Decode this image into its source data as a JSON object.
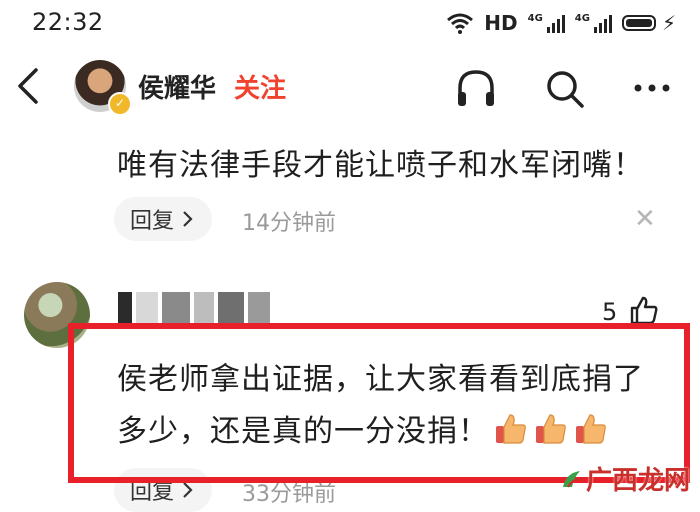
{
  "status_bar": {
    "time": "22:32",
    "hd": "HD",
    "net1": "4G",
    "net2": "4G"
  },
  "header": {
    "username": "侯耀华",
    "follow_label": "关注",
    "icons": [
      "back-icon",
      "headphones-icon",
      "search-icon",
      "more-icon"
    ]
  },
  "comments": [
    {
      "text": "唯有法律手段才能让喷子和水军闭嘴！",
      "reply_label": "回复",
      "time": "14分钟前"
    },
    {
      "likes": "5",
      "line1": "侯老师拿出证据，让大家看看到底捐了",
      "line2": "多少，还是真的一分没捐！",
      "reply_label": "回复",
      "time": "33分钟前"
    }
  ],
  "watermark": {
    "text": "广西龙网"
  },
  "colors": {
    "follow": "#f0432f",
    "highlight_border": "#e8202a",
    "watermark": "#c9302c"
  }
}
